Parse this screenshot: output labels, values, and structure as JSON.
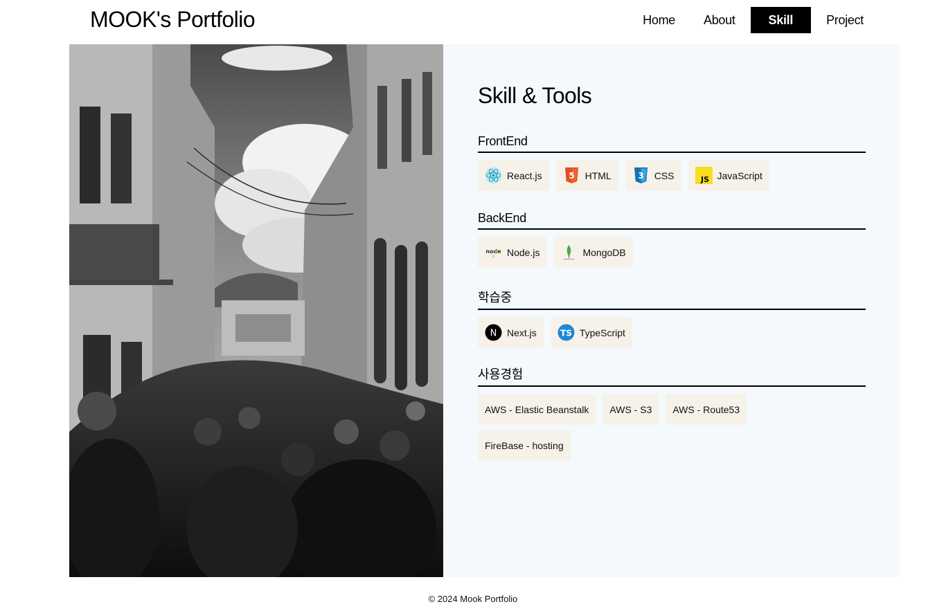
{
  "header": {
    "brand": "MOOK's Portfolio",
    "nav": [
      {
        "label": "Home",
        "active": false
      },
      {
        "label": "About",
        "active": false
      },
      {
        "label": "Skill",
        "active": true
      },
      {
        "label": "Project",
        "active": false
      }
    ]
  },
  "skills": {
    "title": "Skill & Tools",
    "sections": [
      {
        "title": "FrontEnd",
        "items": [
          {
            "label": "React.js",
            "icon": "react-icon"
          },
          {
            "label": "HTML",
            "icon": "html5-icon"
          },
          {
            "label": "CSS",
            "icon": "css3-icon"
          },
          {
            "label": "JavaScript",
            "icon": "javascript-icon"
          }
        ]
      },
      {
        "title": "BackEnd",
        "items": [
          {
            "label": "Node.js",
            "icon": "nodejs-icon"
          },
          {
            "label": "MongoDB",
            "icon": "mongodb-icon"
          }
        ]
      },
      {
        "title": "학습중",
        "items": [
          {
            "label": "Next.js",
            "icon": "nextjs-icon"
          },
          {
            "label": "TypeScript",
            "icon": "typescript-icon"
          }
        ]
      },
      {
        "title": "사용경험",
        "items": [
          {
            "label": "AWS - Elastic Beanstalk"
          },
          {
            "label": "AWS - S3"
          },
          {
            "label": "AWS - Route53"
          },
          {
            "label": "FireBase - hosting"
          }
        ]
      }
    ]
  },
  "colors": {
    "panel_bg": "#f4f9fe",
    "chip_bg": "#f6f2ea",
    "nav_active_bg": "#000000"
  },
  "footer": {
    "text": "© 2024 Mook Portfolio"
  }
}
